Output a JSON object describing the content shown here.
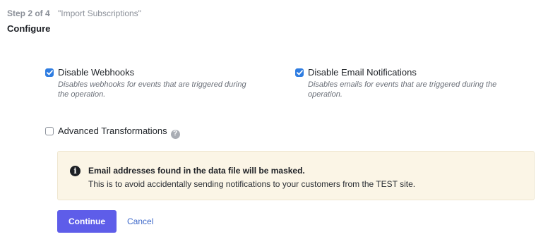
{
  "header": {
    "step": "Step 2 of 4",
    "step_name": "\"Import Subscriptions\"",
    "section_title": "Configure"
  },
  "options": {
    "webhooks": {
      "label": "Disable Webhooks",
      "description": "Disables webhooks for events that are triggered during the operation.",
      "checked": true
    },
    "email_notifications": {
      "label": "Disable Email Notifications",
      "description": "Disables emails for events that are triggered during the operation.",
      "checked": true
    },
    "advanced_transformations": {
      "label": "Advanced Transformations",
      "checked": false,
      "help_icon": "question-circle-icon"
    }
  },
  "notice": {
    "icon": "info-circle-icon",
    "title": "Email addresses found in the data file will be masked.",
    "body": "This is to avoid accidentally sending notifications to your customers from the TEST site."
  },
  "actions": {
    "continue_label": "Continue",
    "cancel_label": "Cancel"
  },
  "colors": {
    "primary": "#5e5de9",
    "checkbox": "#2f7de1",
    "link": "#3d68c9",
    "notice_bg": "#fbf5e6"
  }
}
